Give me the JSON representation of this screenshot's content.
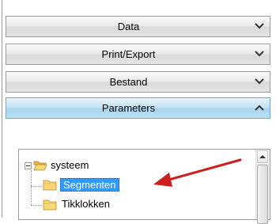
{
  "sections": [
    {
      "label": "Data",
      "state": "collapsed"
    },
    {
      "label": "Print/Export",
      "state": "collapsed"
    },
    {
      "label": "Bestand",
      "state": "collapsed"
    },
    {
      "label": "Parameters",
      "state": "expanded"
    }
  ],
  "tree": {
    "root": {
      "label": "systeem",
      "expanded": true
    },
    "children": [
      {
        "label": "Segmenten",
        "selected": true
      },
      {
        "label": "Tikklokken",
        "selected": false
      }
    ]
  },
  "colors": {
    "selection": "#3399ff",
    "active_header": "#a9d5ef",
    "arrow": "#cc1f1f",
    "folder": "#f2c94c"
  }
}
